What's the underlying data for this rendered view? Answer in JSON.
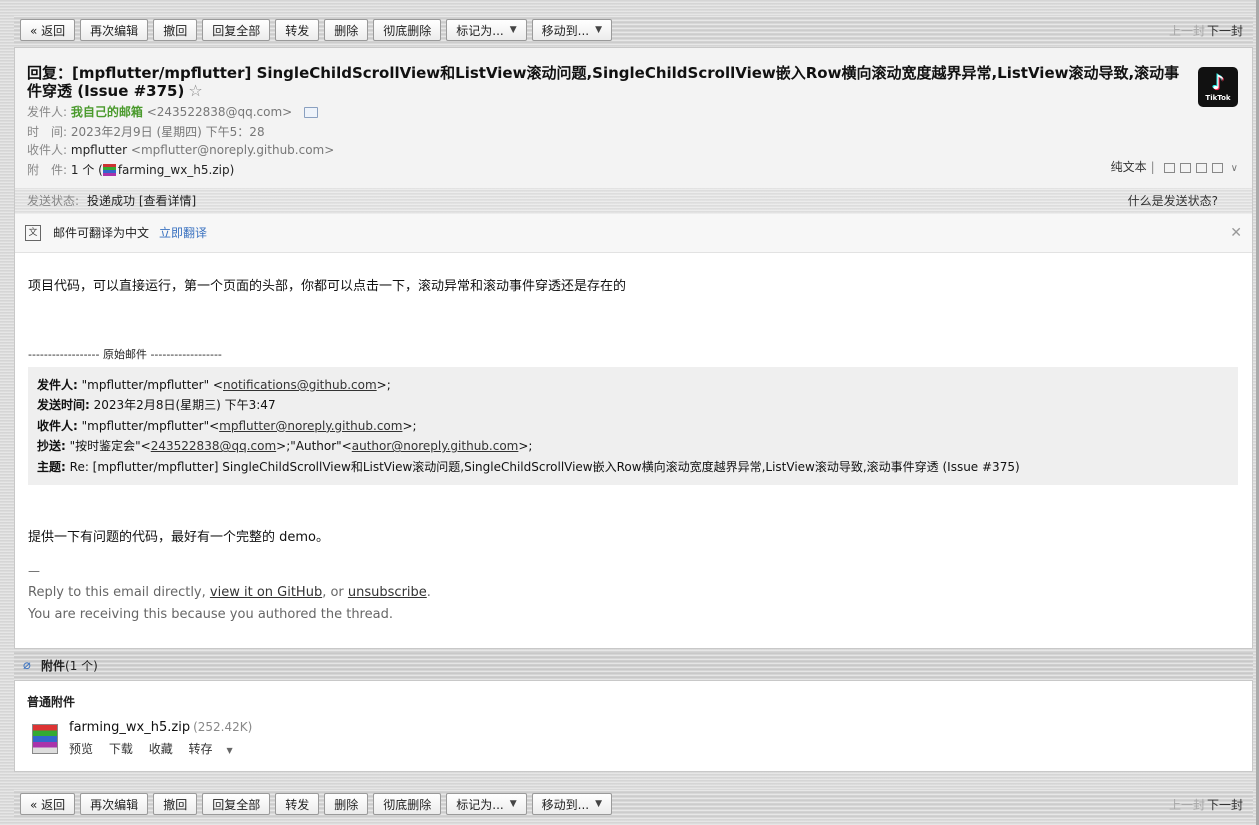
{
  "toolbar": {
    "back": "« 返回",
    "edit_again": "再次编辑",
    "recall": "撤回",
    "reply_all": "回复全部",
    "forward": "转发",
    "delete": "删除",
    "delete_forever": "彻底删除",
    "mark_as": "标记为...",
    "move_to": "移动到...",
    "prev": "上一封",
    "next": "下一封"
  },
  "email": {
    "subject": "回复：[mpflutter/mpflutter] SingleChildScrollView和ListView滚动问题,SingleChildScrollView嵌入Row横向滚动宽度越界异常,ListView滚动导致,滚动事件穿透 (Issue #375)",
    "sender_label": "发件人:",
    "sender_name": "我自己的邮箱",
    "sender_email": "<243522838@qq.com>",
    "time_label": "时　间:",
    "time_value": "2023年2月9日 (星期四) 下午5：28",
    "to_label": "收件人:",
    "to_name": "mpflutter",
    "to_email": "<mpflutter@noreply.github.com>",
    "attach_label": "附　件:",
    "attach_count": "1 个 (",
    "attach_name": "farming_wx_h5.zip",
    "attach_close": ")",
    "view_plain": "纯文本",
    "status_label": "发送状态:",
    "status_value": "投递成功 [查看详情]",
    "status_help": "什么是发送状态?"
  },
  "translate": {
    "text": "邮件可翻译为中文",
    "action": "立即翻译",
    "icon": "translate-icon"
  },
  "body": {
    "line1": "项目代码，可以直接运行，第一个页面的头部，你都可以点击一下，滚动异常和滚动事件穿透还是存在的",
    "orig_separator": "------------------ 原始邮件 ------------------",
    "quote": {
      "from_label": "发件人:",
      "from_value": "\"mpflutter/mpflutter\" <",
      "from_link": "notifications@github.com",
      "from_tail": ">;",
      "sent_label": "发送时间:",
      "sent_value": "2023年2月8日(星期三) 下午3:47",
      "to_label": "收件人:",
      "to_value": "\"mpflutter/mpflutter\"<",
      "to_link": "mpflutter@noreply.github.com",
      "to_tail": ">;",
      "cc_label": "抄送:",
      "cc_value1": "\"按时鉴定会\"<",
      "cc_link1": "243522838@qq.com",
      "cc_value2": ">;\"Author\"<",
      "cc_link2": "author@noreply.github.com",
      "cc_tail": ">;",
      "subject_label": "主题:",
      "subject_value": "Re: [mpflutter/mpflutter] SingleChildScrollView和ListView滚动问题,SingleChildScrollView嵌入Row横向滚动宽度越界异常,ListView滚动导致,滚动事件穿透 (Issue #375)"
    },
    "reply_text": "提供一下有问题的代码，最好有一个完整的 demo。",
    "dash": "—",
    "footer1_pre": "Reply to this email directly, ",
    "footer1_link1": "view it on GitHub",
    "footer1_mid": ", or ",
    "footer1_link2": "unsubscribe",
    "footer1_end": ".",
    "footer2": "You are receiving this because you authored the thread."
  },
  "attachments": {
    "header_bold": "附件",
    "header_count": "(1 个)",
    "section": "普通附件",
    "file_name": "farming_wx_h5.zip",
    "file_size": "(252.42K)",
    "preview": "预览",
    "download": "下载",
    "favorite": "收藏",
    "save_to": "转存"
  },
  "logo": {
    "text": "TikTok"
  }
}
